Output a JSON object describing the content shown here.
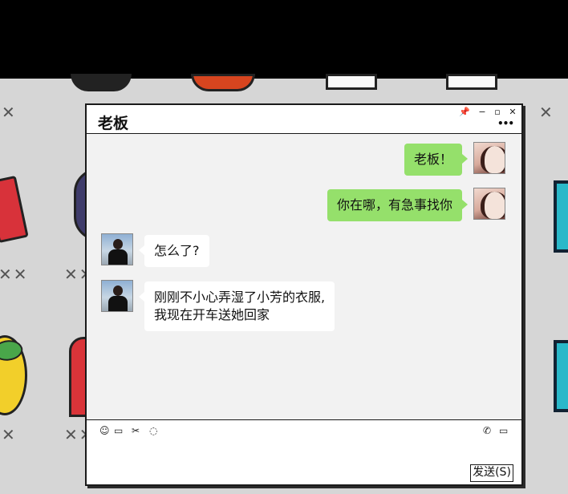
{
  "background": {
    "band_color": "#000000",
    "marks": [
      "✕",
      "✕✕",
      "✕✕",
      "✕✕",
      "✕",
      "✕"
    ]
  },
  "window": {
    "title": "老板",
    "controls": {
      "pin_icon": "📌",
      "minimize": "−",
      "maximize": "▫",
      "close": "✕"
    },
    "more_icon": "•••"
  },
  "messages": [
    {
      "side": "sent",
      "sender": "me",
      "text": "老板！"
    },
    {
      "side": "sent",
      "sender": "me",
      "text": "你在哪，有急事找你"
    },
    {
      "side": "recv",
      "sender": "boss",
      "text": "怎么了?"
    },
    {
      "side": "recv",
      "sender": "boss",
      "lines": [
        "刚刚不小心弄湿了小芳的衣服,",
        "我现在开车送她回家"
      ]
    }
  ],
  "toolbar": {
    "emoji_icon": "☺",
    "folder_icon": "▭",
    "scissors_icon": "✂",
    "chat_icon": "◌",
    "phone_icon": "✆",
    "video_icon": "▭"
  },
  "send_button": {
    "label": "发送(S)"
  },
  "colors": {
    "sent_bubble": "#95e06b",
    "recv_bubble": "#ffffff",
    "chat_bg": "#f2f2f2"
  }
}
